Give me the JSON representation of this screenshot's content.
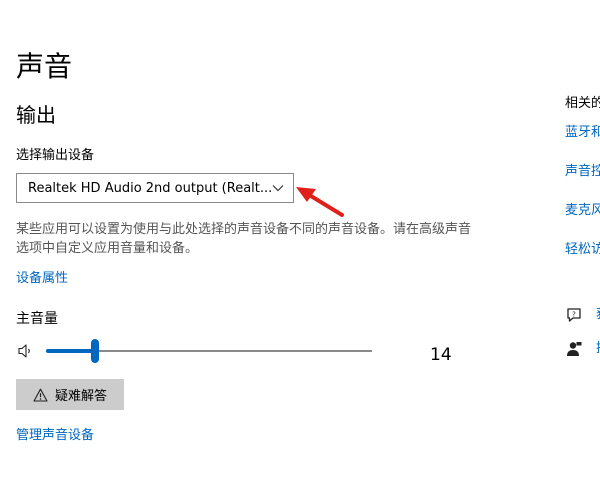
{
  "page": {
    "title": "声音"
  },
  "output": {
    "section_title": "输出",
    "device_label": "选择输出设备",
    "device_value": "Realtek HD Audio 2nd output (Realt...",
    "description": "某些应用可以设置为使用与此处选择的声音设备不同的声音设备。请在高级声音选项中自定义应用音量和设备。",
    "device_properties_link": "设备属性",
    "master_volume_label": "主音量",
    "volume_value": "14",
    "volume_level": 0.15,
    "troubleshoot_label": "疑难解答",
    "manage_devices_link": "管理声音设备"
  },
  "related": {
    "heading": "相关的",
    "links": [
      "蓝牙和",
      "声音控",
      "麦克风",
      "轻松访"
    ]
  },
  "help": {
    "items": [
      {
        "icon": "chat-help-icon",
        "label": "获"
      },
      {
        "icon": "feedback-person-icon",
        "label": "提"
      }
    ]
  },
  "colors": {
    "accent": "#0067c0",
    "annotation_arrow": "#e0211b"
  }
}
